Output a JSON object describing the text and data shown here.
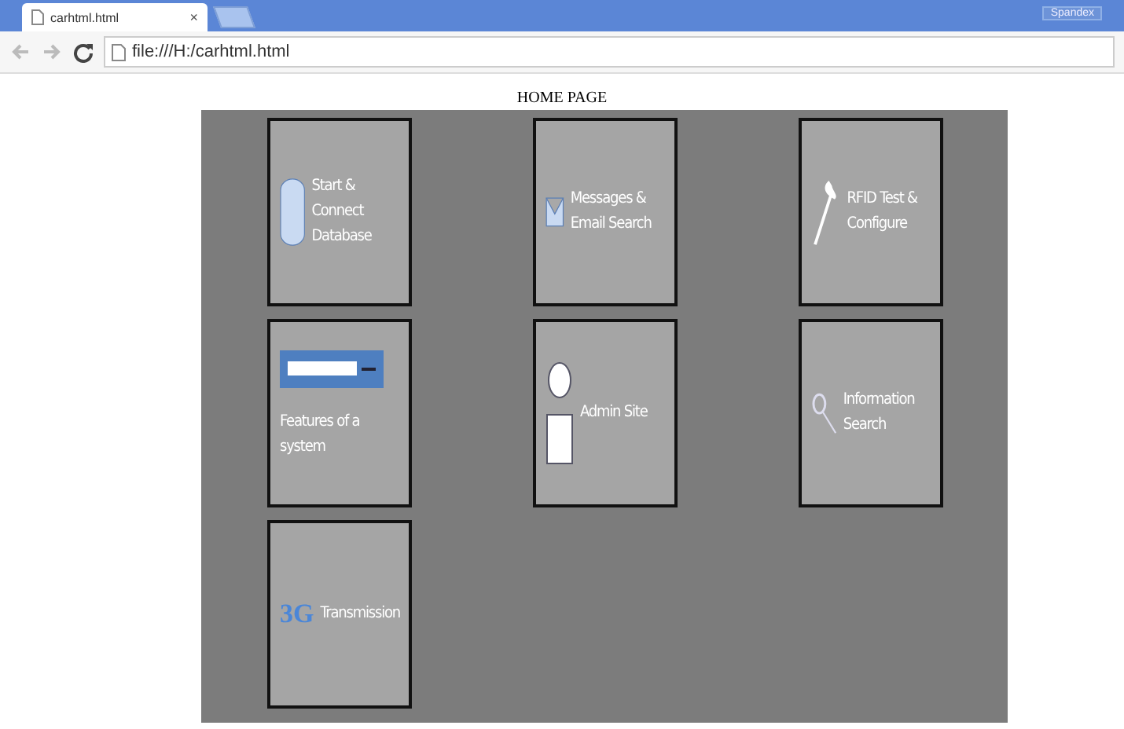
{
  "browser": {
    "tab_title": "carhtml.html",
    "tab_close": "×",
    "profile": "Spandex",
    "address": "file:///H:/carhtml.html"
  },
  "page": {
    "heading": "HOME PAGE",
    "tiles": [
      {
        "kind": "database",
        "label": "Start & Connect Database"
      },
      {
        "kind": "mail",
        "label": "Messages & Email Search"
      },
      {
        "kind": "rfid",
        "label": "RFID Test & Configure"
      },
      {
        "kind": "searchbar",
        "label": "Features of a system"
      },
      {
        "kind": "person",
        "label": "Admin Site"
      },
      {
        "kind": "magnifier",
        "label": "Information Search"
      },
      {
        "kind": "network",
        "badge": "3G",
        "label": "Transmission"
      }
    ]
  }
}
